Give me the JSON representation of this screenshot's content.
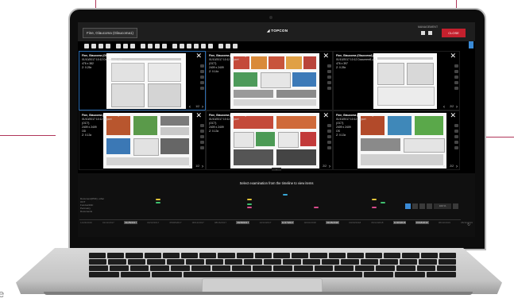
{
  "app": {
    "patient_label": "Fine, Glaucoma (Glaucoma1)",
    "brand": "◢ TOPCON",
    "management_label": "MANAGEMENT",
    "close_label": "CLOSE"
  },
  "viewers": [
    {
      "name": "Fine, Glaucoma (Glaucoma1)",
      "lines": [
        "01/10/2017 10:12 Document1.pdf",
        "476 x 382",
        "Z: 0.25x"
      ],
      "page": "1/2"
    },
    {
      "name": "Fine, Glaucoma (Glaucoma1)",
      "lines": [
        "01/10/2017 10:12 Report",
        "(OCT)",
        "2409 x 2409",
        "Z: 0.14x"
      ],
      "page": ""
    },
    {
      "name": "Fine, Glaucoma (Glaucoma1)",
      "lines": [
        "01/10/2017 10:12 Document1.pdf",
        "476 x 397",
        "Z: 0.25x"
      ],
      "page": "2/2"
    },
    {
      "name": "Fine, Glaucoma (Glaucoma1)",
      "lines": [
        "01/10/2017 10:12 Report",
        "(OCT)",
        "2409 x 2409",
        "OD",
        "Z: 0.13x"
      ],
      "page": "1/2"
    },
    {
      "name": "Fine, Glaucoma (Glaucoma1)",
      "lines": [
        "01/10/2017 10:12 Report",
        "(OCT)",
        "2409 x 2409",
        "Z: 0.13x"
      ],
      "page": "2/2"
    },
    {
      "name": "Fine, Glaucoma (Glaucoma1)",
      "lines": [
        "01/10/2017 10:12 Report",
        "(OCT)",
        "2409 x 2409",
        "OS",
        "Z: 0.13x"
      ],
      "page": "2/2"
    }
  ],
  "timeline": {
    "message": "Select examination from the timeline to view items",
    "row_labels": [
      "Document(PDF), other",
      "OCT",
      "Fundus/FAF",
      "Perimetry",
      "Documents"
    ],
    "dates": [
      "11/23/2016",
      "01/11/2017",
      "01/25/2017",
      "03/10/2017",
      "05/08/2017",
      "06/12/2017",
      "08/16/2017",
      "09/28/2017",
      "10/13/2017",
      "11/17/2017",
      "02/01/2018",
      "02/26/2018",
      "03/20/2018",
      "06/14/2018",
      "11/20/2018",
      "03/18/2019",
      "06/22/2019",
      "08/11/2019"
    ],
    "highlighted_dates": [
      "01/25/2017",
      "09/28/2017",
      "11/17/2017",
      "02/26/2018",
      "11/20/2018",
      "03/18/2019"
    ],
    "zoom_value": "100 %",
    "marker_colors": [
      "#e0c33a",
      "#3fbf6f",
      "#e0c33a",
      "#d94b8c",
      "#38a7d6"
    ]
  }
}
